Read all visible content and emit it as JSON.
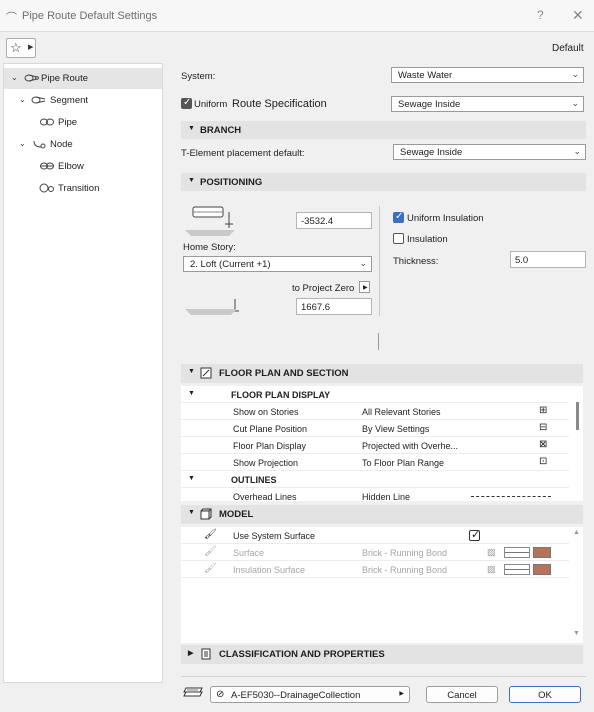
{
  "window": {
    "title": "Pipe Route Default Settings",
    "help": "?",
    "close": "✕"
  },
  "header": {
    "default_label": "Default"
  },
  "tree": [
    {
      "label": "Pipe Route"
    },
    {
      "label": "Segment"
    },
    {
      "label": "Pipe"
    },
    {
      "label": "Node"
    },
    {
      "label": "Elbow"
    },
    {
      "label": "Transition"
    }
  ],
  "system": {
    "label": "System:",
    "value": "Waste Water"
  },
  "uniform_route": {
    "prefix": "Uniform",
    "label": "Route Specification",
    "value": "Sewage Inside",
    "checked": true
  },
  "branch": {
    "title": "BRANCH",
    "tee_label": "T-Element placement default:",
    "tee_value": "Sewage Inside"
  },
  "positioning": {
    "title": "POSITIONING",
    "top_value": "-3532.4",
    "home_story_label": "Home Story:",
    "home_story_value": "2. Loft (Current +1)",
    "ref_label": "to Project Zero",
    "bottom_value": "1667.6",
    "uniform_insulation": "Uniform Insulation",
    "insulation": "Insulation",
    "thickness_label": "Thickness:",
    "thickness_value": "5.0"
  },
  "floor_plan": {
    "title": "FLOOR PLAN AND SECTION",
    "groups": [
      {
        "title": "FLOOR PLAN DISPLAY",
        "rows": [
          {
            "label": "Show on Stories",
            "value": "All Relevant Stories"
          },
          {
            "label": "Cut Plane Position",
            "value": "By View Settings"
          },
          {
            "label": "Floor Plan Display",
            "value": "Projected with Overhe..."
          },
          {
            "label": "Show Projection",
            "value": "To Floor Plan Range"
          }
        ]
      },
      {
        "title": "OUTLINES",
        "rows": [
          {
            "label": "Overhead Lines",
            "value": "Hidden Line"
          }
        ]
      }
    ]
  },
  "model": {
    "title": "MODEL",
    "rows": [
      {
        "label": "Use System Surface",
        "value": ""
      },
      {
        "label": "Surface",
        "value": "Brick - Running Bond"
      },
      {
        "label": "Insulation Surface",
        "value": "Brick - Running Bond"
      }
    ]
  },
  "classification": {
    "title": "CLASSIFICATION AND PROPERTIES"
  },
  "footer": {
    "layer": "A-EF5030--DrainageCollection",
    "cancel": "Cancel",
    "ok": "OK"
  },
  "colors": {
    "accent": "#3b6fbf",
    "section_bg": "#e3e3e3",
    "brick": "#b5735d"
  }
}
